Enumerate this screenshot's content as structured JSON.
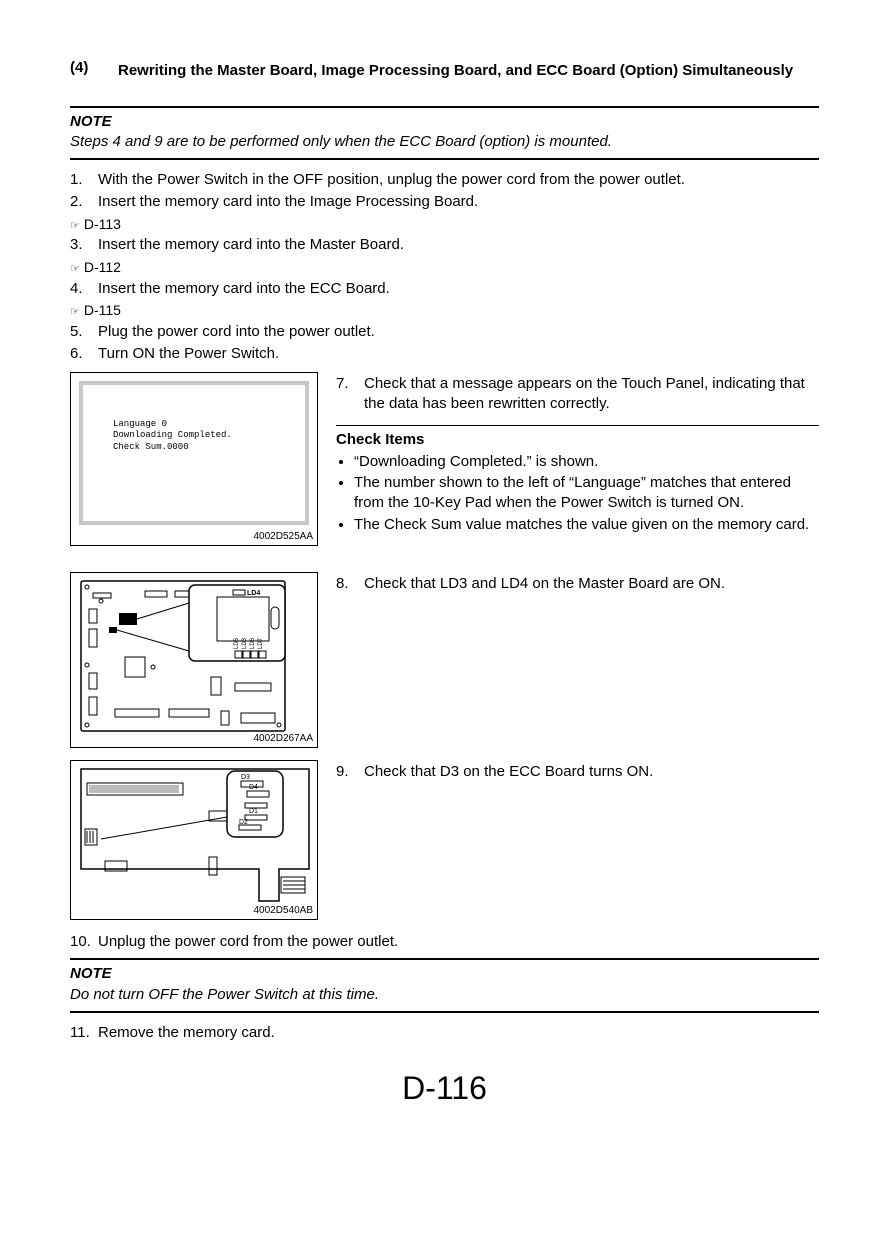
{
  "heading": {
    "number": "(4)",
    "title": "Rewriting the Master Board, Image Processing Board, and ECC Board (Option) Simultaneously"
  },
  "note1": {
    "label": "NOTE",
    "text": "Steps 4 and 9 are to be performed only when the ECC Board (option) is mounted."
  },
  "steps": {
    "s1n": "1.",
    "s1t": "With the Power Switch in the OFF position, unplug the power cord from the power outlet.",
    "s2n": "2.",
    "s2t": "Insert the memory card into the Image Processing Board.",
    "ref2": "D-113",
    "s3n": "3.",
    "s3t": "Insert the memory card into the Master Board.",
    "ref3": "D-112",
    "s4n": "4.",
    "s4t": "Insert the memory card into the ECC Board.",
    "ref4": "D-115",
    "s5n": "5.",
    "s5t": "Plug the power cord into the power outlet.",
    "s6n": "6.",
    "s6t": "Turn ON the Power Switch.",
    "s7n": "7.",
    "s7t": "Check that a message appears on the Touch Panel, indicating that the data has been rewritten correctly.",
    "s8n": "8.",
    "s8t": "Check that LD3 and LD4 on the Master Board are ON.",
    "s9n": "9.",
    "s9t": "Check that D3 on the ECC Board turns ON.",
    "s10n": "10.",
    "s10t": "Unplug the power cord from the power outlet.",
    "s11n": "11.",
    "s11t": "Remove the memory card."
  },
  "fig1": {
    "screen_l1": "Language 0",
    "screen_l2": "Downloading Completed.",
    "screen_l3": "Check Sum.0000",
    "caption": "4002D525AA"
  },
  "check": {
    "heading": "Check Items",
    "b1": "“Downloading Completed.” is shown.",
    "b2": "The number shown to the left of “Language” matches that entered from the 10-Key Pad when the Power Switch is turned ON.",
    "b3": "The Check Sum value matches the value given on the memory card."
  },
  "fig2": {
    "caption": "4002D267AA",
    "ld4": "LD4",
    "ld5": "LD5",
    "ld3": "LD3",
    "ld6": "LD6",
    "ld7": "LD7"
  },
  "fig3": {
    "caption": "4002D540AB",
    "d1": "D1",
    "d2": "D2",
    "d3": "D3",
    "d4": "D4"
  },
  "note2": {
    "label": "NOTE",
    "text": "Do not turn OFF the Power Switch at this time."
  },
  "page_number": "D-116"
}
